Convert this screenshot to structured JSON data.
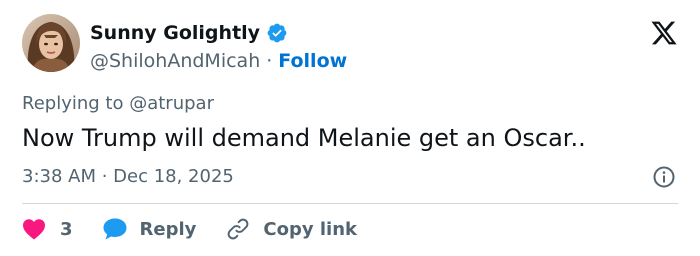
{
  "author": {
    "display_name": "Sunny Golightly",
    "handle": "@ShilohAndMicah",
    "separator": "·",
    "follow_label": "Follow",
    "verified": true
  },
  "tweet": {
    "replying_prefix": "Replying to",
    "replying_to": "@atrupar",
    "text": "Now Trump will demand Melanie get an Oscar..",
    "timestamp": "3:38 AM · Dec 18, 2025"
  },
  "actions": {
    "like_count": "3",
    "reply_label": "Reply",
    "copy_link_label": "Copy link"
  },
  "icons": {
    "verified": "verified-badge-icon",
    "brand": "x-logo-icon",
    "info": "info-icon",
    "like": "heart-icon",
    "reply": "speech-bubble-icon",
    "copy": "link-icon"
  },
  "colors": {
    "text_primary": "#0f1419",
    "text_secondary": "#536471",
    "accent": "#0074d4",
    "verified": "#1d9bf0",
    "like": "#f91880",
    "divider": "#cfd9de"
  }
}
